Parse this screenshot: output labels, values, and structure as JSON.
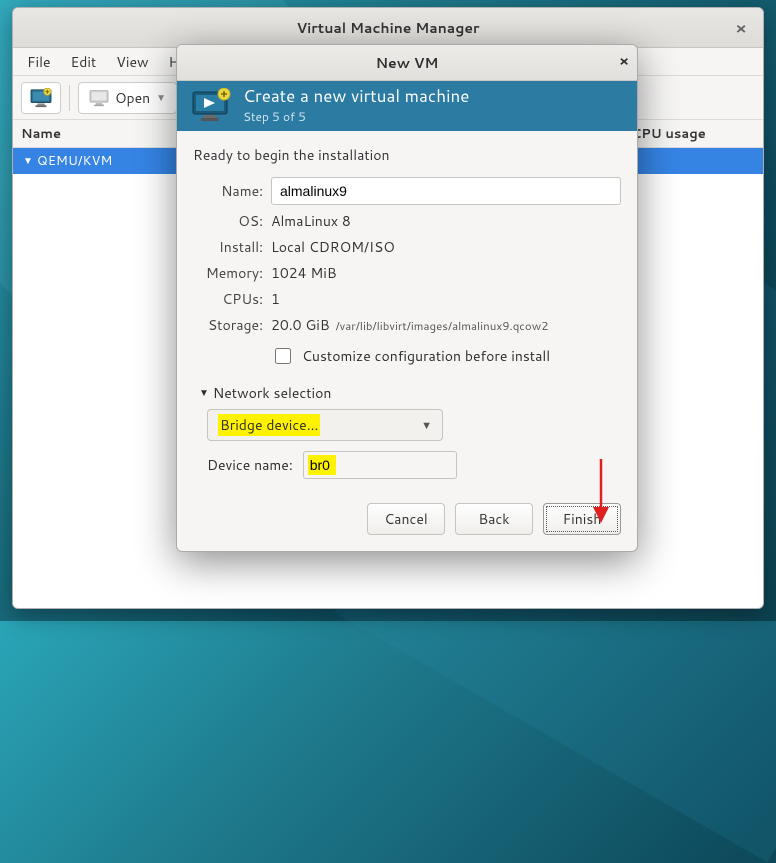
{
  "main_window": {
    "title": "Virtual Machine Manager",
    "menubar": [
      "File",
      "Edit",
      "View",
      "Help"
    ],
    "toolbar": {
      "open": "Open"
    },
    "columns": {
      "name": "Name",
      "cpu": "CPU usage"
    },
    "rows": [
      {
        "label": "QEMU/KVM"
      }
    ]
  },
  "dialog": {
    "title": "New VM",
    "header_title": "Create a new virtual machine",
    "header_subtitle": "Step 5 of 5",
    "ready": "Ready to begin the installation",
    "labels": {
      "name": "Name:",
      "os": "OS:",
      "install": "Install:",
      "memory": "Memory:",
      "cpus": "CPUs:",
      "storage": "Storage:",
      "devname": "Device name:"
    },
    "values": {
      "name": "almalinux9",
      "os": "AlmaLinux 8",
      "install": "Local CDROM/ISO",
      "memory": "1024 MiB",
      "cpus": "1",
      "storage_size": "20.0 GiB",
      "storage_path": "/var/lib/libvirt/images/almalinux9.qcow2",
      "devname": "br0"
    },
    "customize": "Customize configuration before install",
    "network_section": "Network selection",
    "network_combo": "Bridge device...",
    "buttons": {
      "cancel": "Cancel",
      "back": "Back",
      "finish": "Finish"
    }
  }
}
